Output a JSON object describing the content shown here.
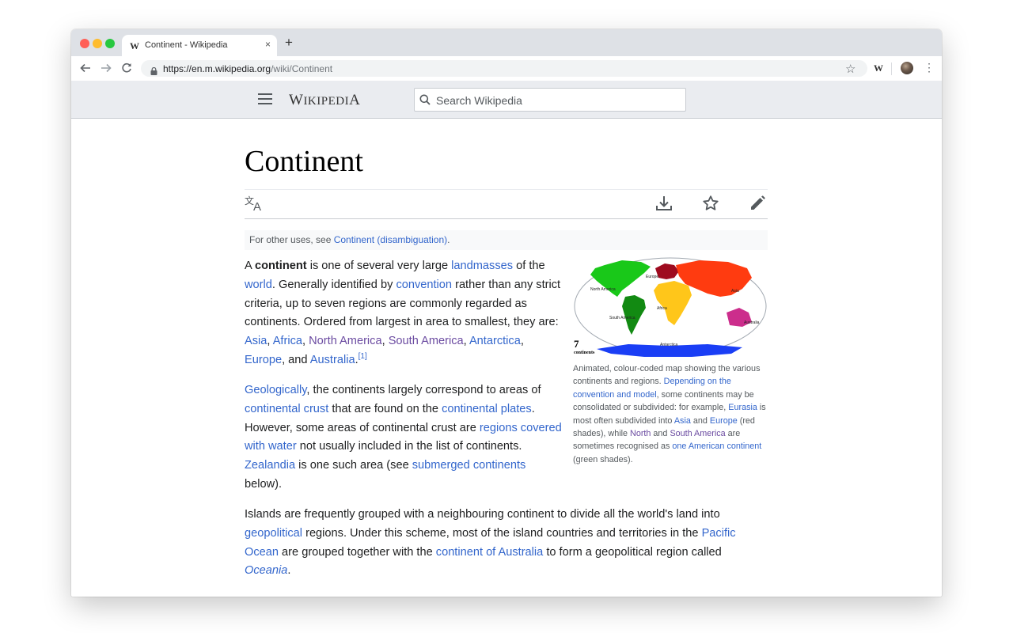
{
  "browser": {
    "tab_icon_letter": "W",
    "tab_title": "Continent - Wikipedia",
    "tab_close": "×",
    "new_tab": "+",
    "url_host": "https://en.m.wikipedia.org",
    "url_path": "/wiki/Continent",
    "extension_letter": "W"
  },
  "site": {
    "wordmark_first": "W",
    "wordmark_rest": "IKIPEDI",
    "wordmark_last": "A",
    "search_placeholder": "Search Wikipedia"
  },
  "article": {
    "title": "Continent",
    "hatnote_prefix": "For other uses, see ",
    "hatnote_link": "Continent (disambiguation)",
    "hatnote_suffix": ".",
    "p1": {
      "t1": "A ",
      "bold": "continent",
      "t2": " is one of several very large ",
      "l_landmasses": "landmasses",
      "t3": " of the ",
      "l_world": "world",
      "t4": ". Generally identified by ",
      "l_convention": "convention",
      "t5": " rather than any strict criteria, up to seven regions are commonly regarded as continents. Ordered from largest in area to smallest, they are: ",
      "l_asia": "Asia",
      "c1": ", ",
      "l_africa": "Africa",
      "c2": ", ",
      "l_namerica": "North America",
      "c3": ", ",
      "l_samerica": "South America",
      "c4": ", ",
      "l_antarctica": "Antarctica",
      "c5": ", ",
      "l_europe": "Europe",
      "c6": ", and ",
      "l_australia": "Australia",
      "c7": ".",
      "ref": "[1]"
    },
    "p2": {
      "l_geologically": "Geologically",
      "t1": ", the continents largely correspond to areas of ",
      "l_crust": "continental crust",
      "t2": " that are found on the ",
      "l_plates": "continental plates",
      "t3": ". However, some areas of continental crust are ",
      "l_regions": "regions covered with water",
      "t4": " not usually included in the list of continents. ",
      "l_zealandia": "Zealandia",
      "t5": " is one such area (see ",
      "l_submerged": "submerged continents",
      "t6": " below)."
    },
    "p3": {
      "t1": "Islands are frequently grouped with a neighbouring continent to divide all the world's land into ",
      "l_geopolitical": "geopolitical",
      "t2": " regions. Under this scheme, most of the island countries and territories in the ",
      "l_pacific": "Pacific Ocean",
      "t3": " are grouped together with the ",
      "l_australia": "continent of Australia",
      "t4": " to form a geopolitical region called ",
      "l_oceania": "Oceania",
      "t5": "."
    },
    "map_labels": {
      "north_america": "North America",
      "south_america": "South America",
      "europe": "Europe",
      "asia": "Asia",
      "africa": "Africa",
      "australia": "Australia",
      "antarctica": "Antarctica",
      "count": "7",
      "count_word": "continents"
    },
    "caption": {
      "t1": "Animated, colour-coded map showing the various continents and regions. ",
      "l_depending": "Depending on the convention and model",
      "t2": ", some continents may be consolidated or subdivided: for example, ",
      "l_eurasia": "Eurasia",
      "t3": " is most often subdivided into ",
      "l_asia": "Asia",
      "t4": " and ",
      "l_europe": "Europe",
      "t5": " (red shades), while ",
      "l_north": "North",
      "t6": " and ",
      "l_southamerica": "South America",
      "t7": " are sometimes recognised as ",
      "l_one_american": "one American continent",
      "t8": " (green shades)."
    }
  }
}
